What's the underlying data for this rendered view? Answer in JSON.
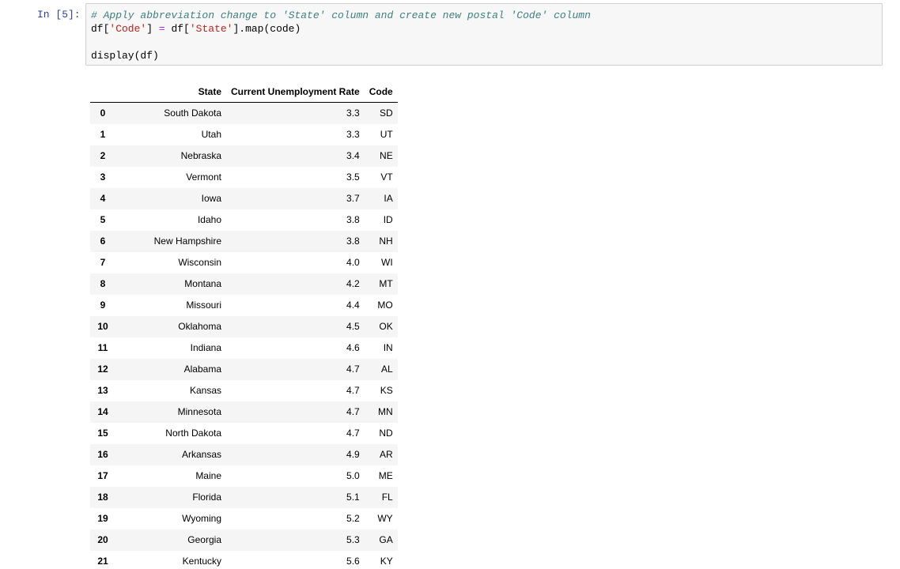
{
  "cell": {
    "prompt": "In [5]:",
    "code": {
      "comment": "# Apply abbreviation change to 'State' column and create new postal 'Code' column",
      "line2_a": "df[",
      "line2_b": "'Code'",
      "line2_c": "] ",
      "line2_d": "=",
      "line2_e": " df[",
      "line2_f": "'State'",
      "line2_g": "].map(code)",
      "line4": "display(df)"
    }
  },
  "table": {
    "headers": [
      "",
      "State",
      "Current Unemployment Rate",
      "Code"
    ],
    "rows": [
      [
        "0",
        "South Dakota",
        "3.3",
        "SD"
      ],
      [
        "1",
        "Utah",
        "3.3",
        "UT"
      ],
      [
        "2",
        "Nebraska",
        "3.4",
        "NE"
      ],
      [
        "3",
        "Vermont",
        "3.5",
        "VT"
      ],
      [
        "4",
        "Iowa",
        "3.7",
        "IA"
      ],
      [
        "5",
        "Idaho",
        "3.8",
        "ID"
      ],
      [
        "6",
        "New Hampshire",
        "3.8",
        "NH"
      ],
      [
        "7",
        "Wisconsin",
        "4.0",
        "WI"
      ],
      [
        "8",
        "Montana",
        "4.2",
        "MT"
      ],
      [
        "9",
        "Missouri",
        "4.4",
        "MO"
      ],
      [
        "10",
        "Oklahoma",
        "4.5",
        "OK"
      ],
      [
        "11",
        "Indiana",
        "4.6",
        "IN"
      ],
      [
        "12",
        "Alabama",
        "4.7",
        "AL"
      ],
      [
        "13",
        "Kansas",
        "4.7",
        "KS"
      ],
      [
        "14",
        "Minnesota",
        "4.7",
        "MN"
      ],
      [
        "15",
        "North Dakota",
        "4.7",
        "ND"
      ],
      [
        "16",
        "Arkansas",
        "4.9",
        "AR"
      ],
      [
        "17",
        "Maine",
        "5.0",
        "ME"
      ],
      [
        "18",
        "Florida",
        "5.1",
        "FL"
      ],
      [
        "19",
        "Wyoming",
        "5.2",
        "WY"
      ],
      [
        "20",
        "Georgia",
        "5.3",
        "GA"
      ],
      [
        "21",
        "Kentucky",
        "5.6",
        "KY"
      ]
    ]
  },
  "colors": {
    "prompt": "#303f9f",
    "comment": "#408080",
    "string": "#ba2121",
    "operator": "#aa22ff",
    "input_bg": "#f7f7f7",
    "stripe": "#f5f5f5"
  }
}
